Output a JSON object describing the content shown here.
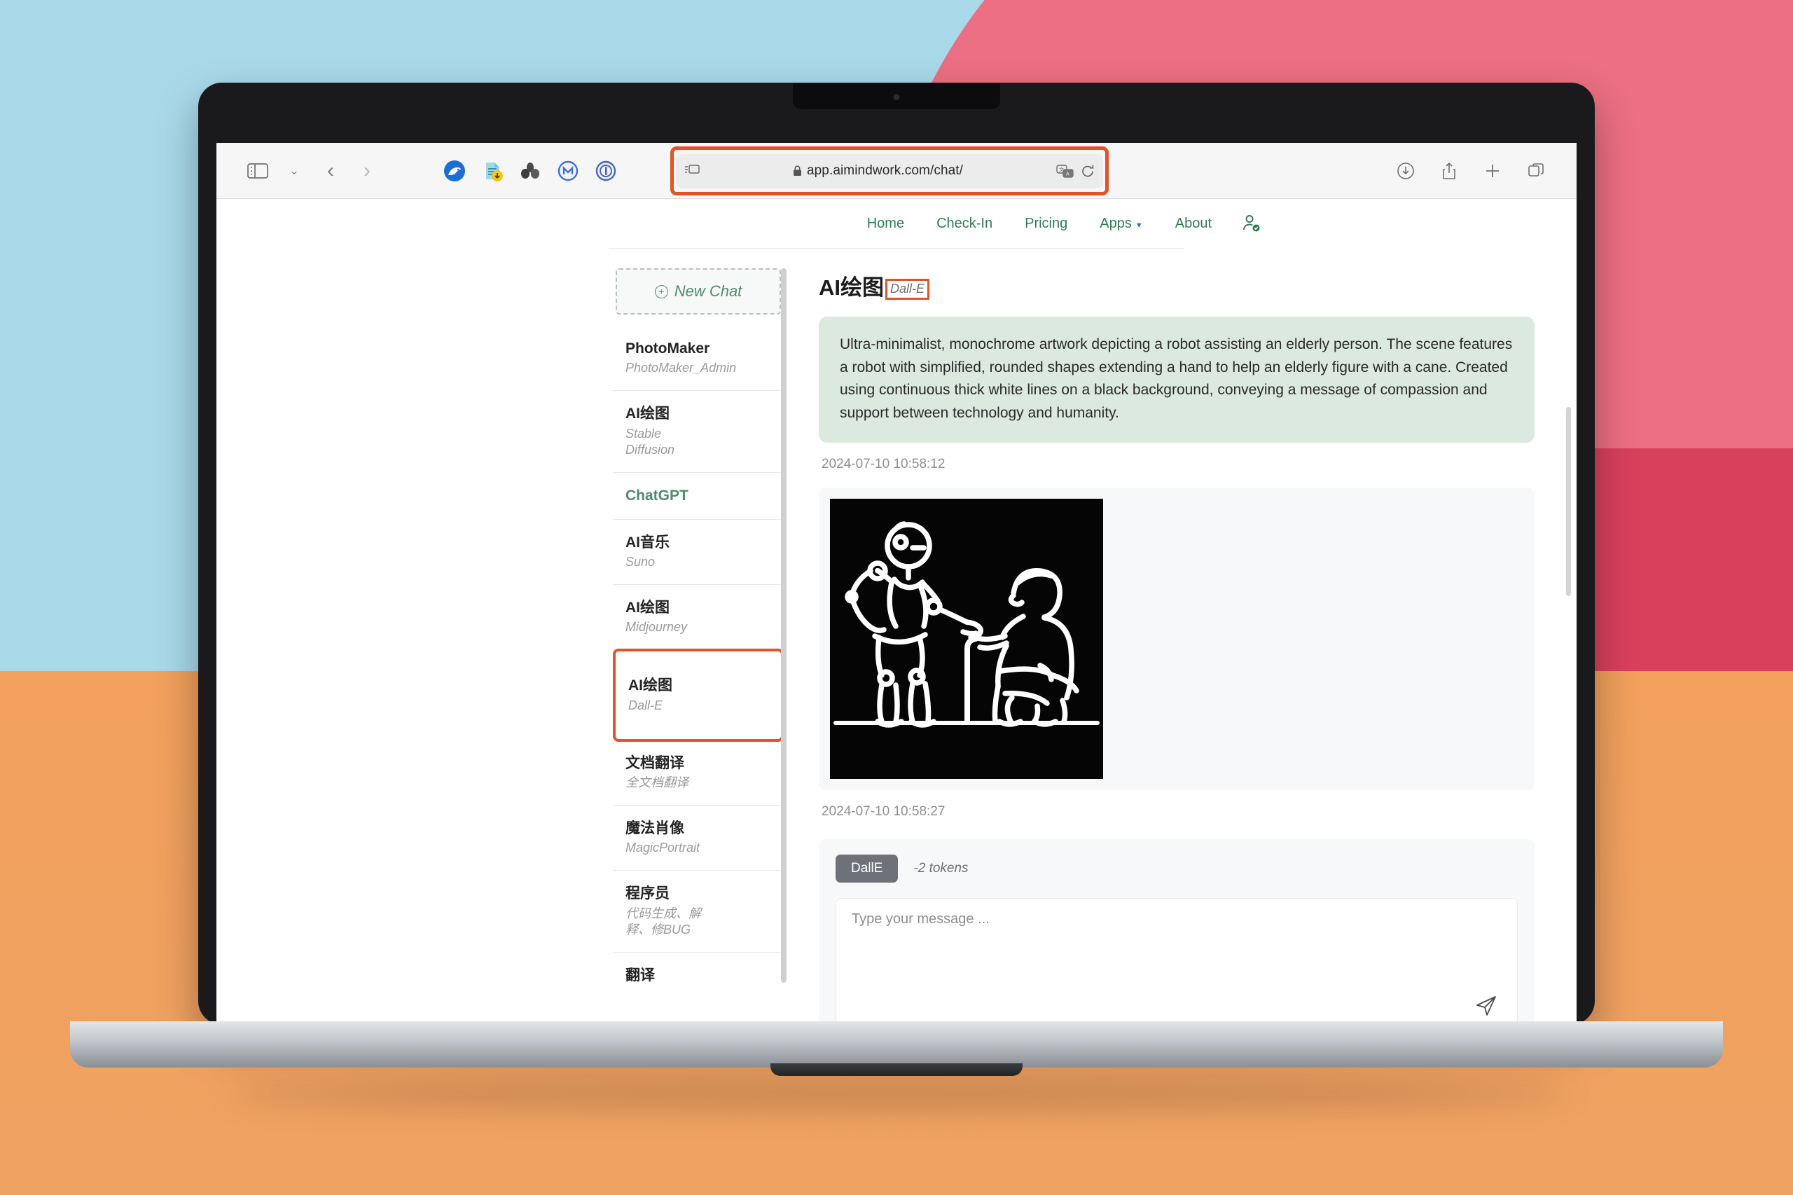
{
  "browser": {
    "url": "app.aimindwork.com/chat/",
    "lock_icon": "lock-icon",
    "reader_icon": "reader-view-icon",
    "translate_icon": "translate-icon",
    "reload_icon": "reload-icon",
    "sidebar_toggle_icon": "sidebar-toggle-icon",
    "tab_overview_icon": "chevron-down-icon",
    "back_icon": "back-arrow-icon",
    "forward_icon": "forward-arrow-icon",
    "extensions": [
      "bear-extension-icon",
      "document-download-extension-icon",
      "cluster-extension-icon",
      "m-circle-extension-icon",
      "password-manager-extension-icon"
    ],
    "right_tools": [
      "downloads-icon",
      "share-icon",
      "new-tab-icon",
      "tab-overview-icon"
    ]
  },
  "site_nav": {
    "links": [
      {
        "label": "Home"
      },
      {
        "label": "Check-In"
      },
      {
        "label": "Pricing"
      },
      {
        "label": "Apps",
        "caret": "▼"
      },
      {
        "label": "About"
      }
    ],
    "avatar_icon": "user-check-icon",
    "accent_color": "#2e7d4f"
  },
  "sidebar": {
    "new_chat_label": "New Chat",
    "new_chat_icon": "plus-circle-icon",
    "items": [
      {
        "title": "PhotoMaker",
        "sub": "PhotoMaker_Admin",
        "accent": false,
        "selected": false
      },
      {
        "title": "AI绘图",
        "sub": "Stable Diffusion",
        "accent": false,
        "selected": false
      },
      {
        "title": "ChatGPT",
        "sub": "",
        "accent": true,
        "selected": false
      },
      {
        "title": "AI音乐",
        "sub": "Suno",
        "accent": false,
        "selected": false
      },
      {
        "title": "AI绘图",
        "sub": "Midjourney",
        "accent": false,
        "selected": false
      },
      {
        "title": "AI绘图",
        "sub": "Dall-E",
        "accent": false,
        "selected": true
      },
      {
        "title": "文档翻译",
        "sub": "全文档翻译",
        "accent": false,
        "selected": false
      },
      {
        "title": "魔法肖像",
        "sub": "MagicPortrait",
        "accent": false,
        "selected": false
      },
      {
        "title": "程序员",
        "sub": "代码生成、解释、修BUG",
        "accent": false,
        "selected": false
      },
      {
        "title": "翻译",
        "sub": "",
        "accent": false,
        "selected": false
      }
    ]
  },
  "chat": {
    "title": "AI绘图",
    "badge": "Dall-E",
    "prompt": "Ultra-minimalist, monochrome artwork depicting a robot assisting an elderly person. The scene features a robot with simplified, rounded shapes extending a hand to help an elderly figure with a cane. Created using continuous thick white lines on a black background, conveying a message of compassion and support between technology and humanity.",
    "prompt_time": "2024-07-10 10:58:12",
    "image_time": "2024-07-10 10:58:27",
    "image_alt": "robot-helping-elderly-line-art",
    "model_chip": "DallE",
    "token_note": "-2 tokens",
    "composer_placeholder": "Type your message ...",
    "composer_value": "",
    "send_icon": "send-paper-plane-icon",
    "highlight_color": "#e2522b"
  }
}
